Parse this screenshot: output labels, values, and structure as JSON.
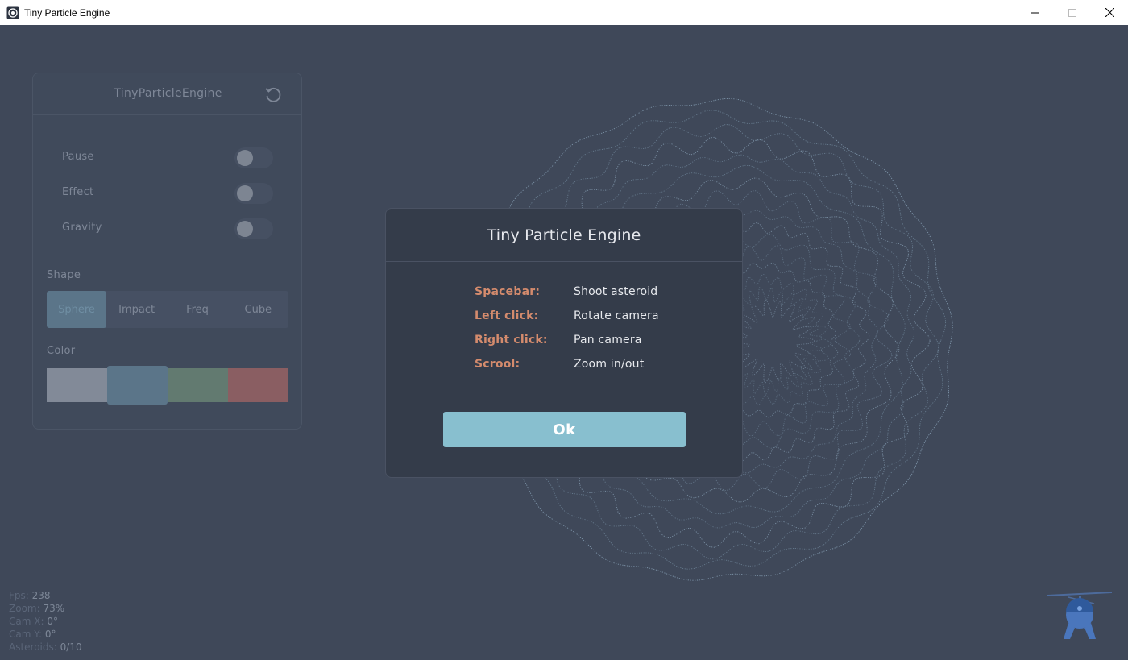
{
  "window": {
    "title": "Tiny Particle Engine",
    "icon": "app-icon",
    "controls": [
      "minimize-icon",
      "maximize-icon",
      "close-icon"
    ]
  },
  "panel": {
    "title": "TinyParticleEngine",
    "reset_icon": "reset-icon",
    "toggles": [
      {
        "label": "Pause",
        "on": false
      },
      {
        "label": "Effect",
        "on": false
      },
      {
        "label": "Gravity",
        "on": false
      }
    ],
    "shape_label": "Shape",
    "shapes": [
      "Sphere",
      "Impact",
      "Freq",
      "Cube"
    ],
    "shape_selected": "Sphere",
    "color_label": "Color",
    "colors": [
      "#828a98",
      "#5b7589",
      "#627a70",
      "#8a5e62"
    ],
    "color_selected_index": 1
  },
  "stats": {
    "fps_label": "Fps:",
    "fps": "238",
    "zoom_label": "Zoom:",
    "zoom": "73%",
    "camx_label": "Cam X:",
    "camx": "0°",
    "camy_label": "Cam Y:",
    "camy": "0°",
    "asteroids_label": "Asteroids:",
    "asteroids": "0/10"
  },
  "modal": {
    "title": "Tiny Particle Engine",
    "keys": [
      {
        "key": "Spacebar:",
        "action": "Shoot asteroid"
      },
      {
        "key": "Left click:",
        "action": "Rotate camera"
      },
      {
        "key": "Right click:",
        "action": "Pan camera"
      },
      {
        "key": "Scrool:",
        "action": "Zoom in/out"
      }
    ],
    "ok_label": "Ok"
  },
  "colors": {
    "background": "#3f4859",
    "accent": "#88bfcf",
    "key_color": "#d48b6d"
  }
}
